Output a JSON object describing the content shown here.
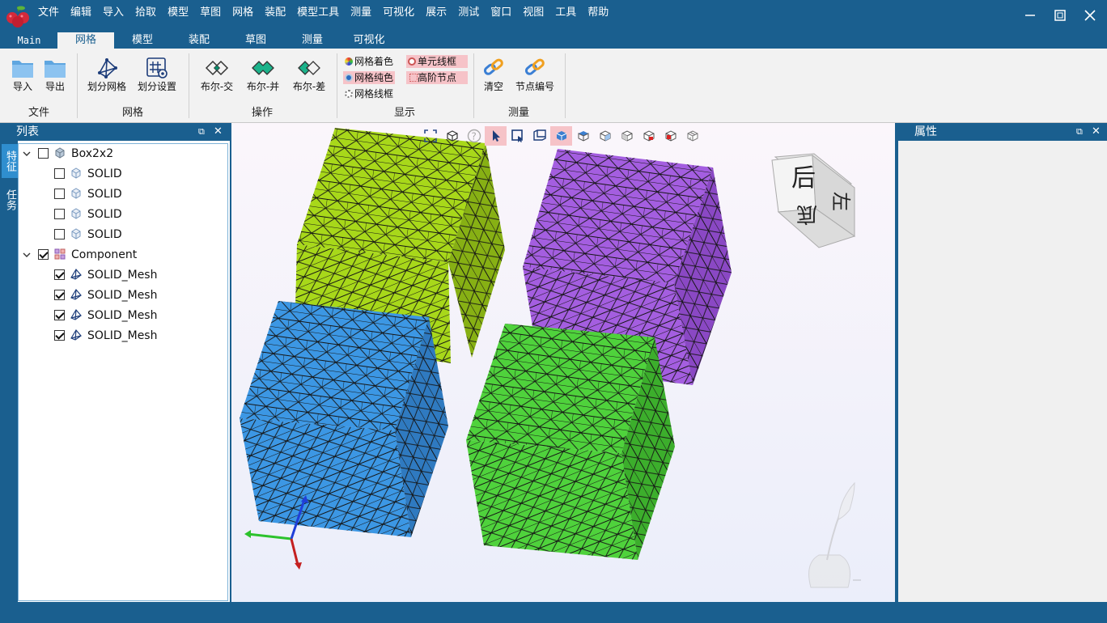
{
  "menu": [
    "文件",
    "编辑",
    "导入",
    "拾取",
    "模型",
    "草图",
    "网格",
    "装配",
    "模型工具",
    "测量",
    "可视化",
    "展示",
    "测试",
    "窗口",
    "视图",
    "工具",
    "帮助"
  ],
  "tabs": [
    "Main",
    "网格",
    "模型",
    "装配",
    "草图",
    "测量",
    "可视化"
  ],
  "active_tab": "网格",
  "ribbon": {
    "file": {
      "import": "导入",
      "export": "导出",
      "group": "文件"
    },
    "mesh": {
      "generate": "划分网格",
      "settings": "划分设置",
      "group": "网格"
    },
    "ops": {
      "intersect": "布尔-交",
      "union": "布尔-并",
      "diff": "布尔-差",
      "group": "操作"
    },
    "display": {
      "mesh_color": "网格着色",
      "mesh_solid": "网格纯色",
      "mesh_wire": "网格线框",
      "elem_wire": "单元线框",
      "high_nodes": "高阶节点",
      "group": "显示"
    },
    "measure": {
      "clear": "清空",
      "node_number": "节点编号",
      "group": "测量"
    }
  },
  "left_panel": {
    "title": "列表",
    "vtabs": [
      "特征",
      "任务"
    ],
    "tree": {
      "root1": "Box2x2",
      "solids": [
        "SOLID",
        "SOLID",
        "SOLID",
        "SOLID"
      ],
      "root2": "Component",
      "meshes": [
        "SOLID_Mesh",
        "SOLID_Mesh",
        "SOLID_Mesh",
        "SOLID_Mesh"
      ]
    }
  },
  "right_panel": {
    "title": "属性"
  },
  "viewcube": {
    "top": "后",
    "front": "底",
    "side": "左"
  },
  "colors": {
    "brand": "#1a5f8f",
    "cube_yellow": "#a8d81a",
    "cube_purple": "#a45ee0",
    "cube_blue": "#3c97e4",
    "cube_green": "#4fd23c",
    "highlight": "#f6c3c8"
  }
}
